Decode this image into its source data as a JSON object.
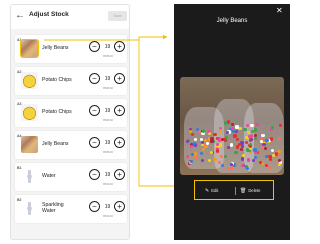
{
  "header": {
    "title": "Adjust Stock",
    "back_icon": "arrow-left-icon",
    "save_label": "Save"
  },
  "items": [
    {
      "slot": "A1",
      "name": "Jelly Beans",
      "qty": "19",
      "price": "RM5.00",
      "thumb": "jelly-beans",
      "selected": true
    },
    {
      "slot": "A2",
      "name": "Potato Chips",
      "qty": "19",
      "price": "RM6.00",
      "thumb": "potato-chips"
    },
    {
      "slot": "A3",
      "name": "Potato Chips",
      "qty": "19",
      "price": "RM6.00",
      "thumb": "potato-chips"
    },
    {
      "slot": "A4",
      "name": "Jelly Beans",
      "qty": "19",
      "price": "RM5.00",
      "thumb": "jelly-beans"
    },
    {
      "slot": "B1",
      "name": "Water",
      "qty": "19",
      "price": "RM3.00",
      "thumb": "water-bottle"
    },
    {
      "slot": "B2",
      "name": "Sparkling Water",
      "qty": "19",
      "price": "RM3.00",
      "thumb": "water-bottle"
    }
  ],
  "detail": {
    "title": "Jelly Beans",
    "close_icon": "close-icon",
    "edit_label": "Edit",
    "delete_label": "Delete",
    "edit_icon": "pencil-icon",
    "delete_icon": "trash-icon"
  },
  "colors": {
    "highlight": "#f2c200",
    "dark_panel": "#1b1b1b",
    "list_bg": "#f4f4f4"
  }
}
